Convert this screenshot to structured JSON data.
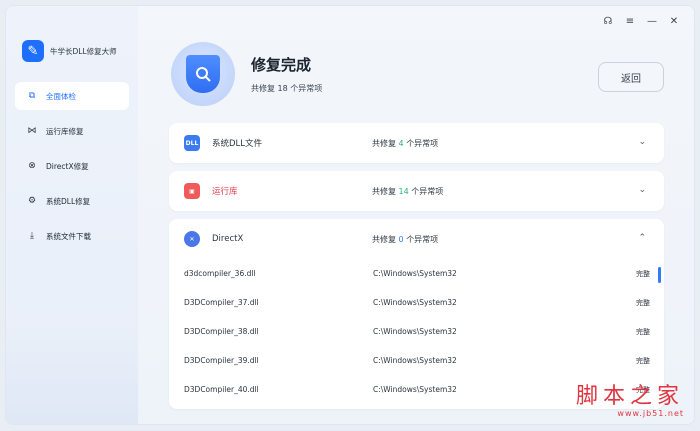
{
  "app": {
    "title": "牛学长DLL修复大师"
  },
  "sidebar": {
    "items": [
      {
        "label": "全面体检",
        "icon": "pulse-monitor-icon",
        "active": true
      },
      {
        "label": "运行库修复",
        "icon": "runtime-icon",
        "active": false
      },
      {
        "label": "DirectX修复",
        "icon": "directx-icon",
        "active": false
      },
      {
        "label": "系统DLL修复",
        "icon": "dll-gear-icon",
        "active": false
      },
      {
        "label": "系统文件下载",
        "icon": "download-icon",
        "active": false
      }
    ]
  },
  "window_controls": [
    "headset-icon",
    "menu-icon",
    "minimize-icon",
    "close-icon"
  ],
  "hero": {
    "title": "修复完成",
    "subtitle_prefix": "共修复",
    "count": "18",
    "subtitle_suffix": "个异常项"
  },
  "back_button": "返回",
  "sections": [
    {
      "label": "系统DLL文件",
      "summary_prefix": "共修复",
      "count": "4",
      "summary_suffix": "个异常项",
      "expanded": false
    },
    {
      "label": "运行库",
      "summary_prefix": "共修复",
      "count": "14",
      "summary_suffix": "个异常项",
      "expanded": false
    },
    {
      "label": "DirectX",
      "summary_prefix": "共修复",
      "count": "0",
      "summary_suffix": "个异常项",
      "expanded": true
    }
  ],
  "files": [
    {
      "name": "d3dcompiler_36.dll",
      "path": "C:\\Windows\\System32",
      "status": "完整"
    },
    {
      "name": "D3DCompiler_37.dll",
      "path": "C:\\Windows\\System32",
      "status": "完整"
    },
    {
      "name": "D3DCompiler_38.dll",
      "path": "C:\\Windows\\System32",
      "status": "完整"
    },
    {
      "name": "D3DCompiler_39.dll",
      "path": "C:\\Windows\\System32",
      "status": "完整"
    },
    {
      "name": "D3DCompiler_40.dll",
      "path": "C:\\Windows\\System32",
      "status": "完整"
    }
  ],
  "watermark": {
    "title": "脚本之家",
    "url": "www.jb51.net"
  },
  "colors": {
    "accent": "#1f6fff",
    "green": "#2bb673",
    "red": "#e8414d"
  }
}
